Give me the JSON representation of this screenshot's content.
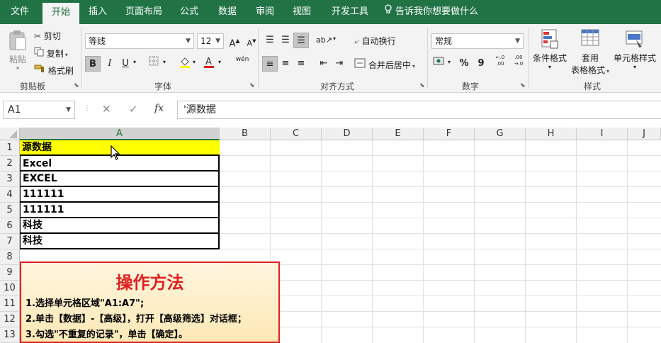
{
  "tabs": [
    "文件",
    "开始",
    "插入",
    "页面布局",
    "公式",
    "数据",
    "审阅",
    "视图",
    "开发工具"
  ],
  "active_tab": "开始",
  "tell_me": "告诉我你想要做什么",
  "clipboard": {
    "paste": "粘贴",
    "cut": "剪切",
    "copy": "复制",
    "format_painter": "格式刷",
    "label": "剪贴板"
  },
  "font": {
    "name": "等线",
    "size": "12",
    "bold": "B",
    "italic": "I",
    "underline": "U",
    "label": "字体",
    "grow": "A",
    "shrink": "A",
    "phonetic": "wén"
  },
  "alignment": {
    "wrap": "自动换行",
    "merge": "合并后居中",
    "label": "对齐方式"
  },
  "number": {
    "format": "常规",
    "percent": "%",
    "comma": "9",
    "label": "数字",
    "inc_decimal": "←.0 .00",
    "dec_decimal": ".00 →.0"
  },
  "styles": {
    "conditional": "条件格式",
    "table_line1": "套用",
    "table_line2": "表格格式",
    "cell_styles": "单元格样式",
    "label": "样式"
  },
  "formula_bar": {
    "name_box": "A1",
    "fx": "fx",
    "content": "'源数据"
  },
  "columns": [
    "A",
    "B",
    "C",
    "D",
    "E",
    "F",
    "G",
    "H",
    "I",
    "J"
  ],
  "rows": [
    "1",
    "2",
    "3",
    "4",
    "5",
    "6",
    "7",
    "8",
    "9",
    "10",
    "11",
    "12",
    "13"
  ],
  "cells": [
    "源数据",
    "Excel",
    "EXCEL",
    "111111",
    "111111",
    "科技",
    "科技"
  ],
  "instructions": {
    "title": "操作方法",
    "step1": "1.选择单元格区域\"A1:A7\";",
    "step2": "2.单击【数据】-【高级】，打开【高级筛选】对话框；",
    "step3": "3.勾选\"不重复的记录\"，单击【确定】。"
  },
  "colors": {
    "ribbon_green": "#217346",
    "header_fill": "#ffff00",
    "title_red": "#e02020"
  }
}
